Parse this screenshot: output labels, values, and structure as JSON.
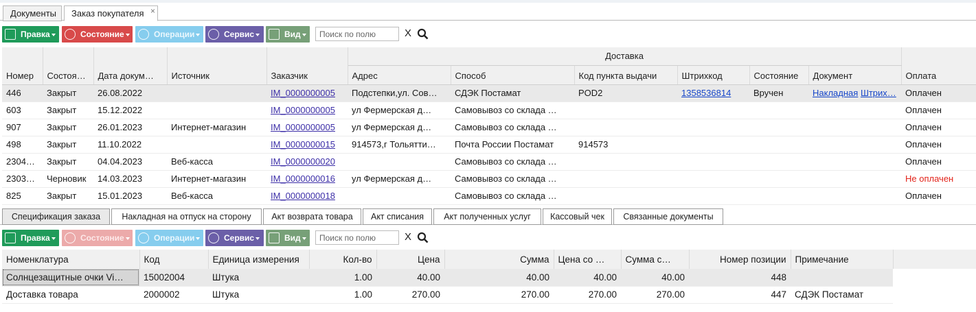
{
  "window_tabs": [
    {
      "label": "Документы"
    },
    {
      "label": "Заказ покупателя",
      "close": "×"
    }
  ],
  "toolbar": {
    "edit": "Правка",
    "state": "Состояние",
    "operations": "Операции",
    "service": "Сервис",
    "view": "Вид",
    "search_placeholder": "Поиск по полю",
    "clear": "X"
  },
  "orders": {
    "group_header": "Доставка",
    "columns": [
      "Номер",
      "Состоя…",
      "Дата докум…",
      "Источник",
      "Заказчик",
      "Адрес",
      "Способ",
      "Код пункта выдачи",
      "Штрихкод",
      "Состояние",
      "Документ",
      "Оплата"
    ],
    "rows": [
      {
        "num": "446",
        "state": "Закрыт",
        "date": "26.08.2022",
        "source": "",
        "customer": "IM_0000000005",
        "address": "Подстепки,ул. Сов…",
        "method": "СДЭК Постамат",
        "pickup": "POD2",
        "barcode": "1358536814",
        "dstate": "Вручен",
        "doc1": "Накладная",
        "doc2": "Штрих…",
        "payment": "Оплачен"
      },
      {
        "num": "603",
        "state": "Закрыт",
        "date": "15.12.2022",
        "source": "",
        "customer": "IM_0000000005",
        "address": "ул Фермерская д…",
        "method": "Самовывоз со склада …",
        "pickup": "",
        "barcode": "",
        "dstate": "",
        "doc1": "",
        "doc2": "",
        "payment": "Оплачен"
      },
      {
        "num": "907",
        "state": "Закрыт",
        "date": "26.01.2023",
        "source": "Интернет-магазин",
        "customer": "IM_0000000005",
        "address": "ул Фермерская д…",
        "method": "Самовывоз со склада …",
        "pickup": "",
        "barcode": "",
        "dstate": "",
        "doc1": "",
        "doc2": "",
        "payment": "Оплачен"
      },
      {
        "num": "498",
        "state": "Закрыт",
        "date": "11.10.2022",
        "source": "",
        "customer": "IM_0000000015",
        "address": "914573,г Тольятти…",
        "method": "Почта России Постамат",
        "pickup": "914573",
        "barcode": "",
        "dstate": "",
        "doc1": "",
        "doc2": "",
        "payment": "Оплачен"
      },
      {
        "num": "2304…",
        "state": "Закрыт",
        "date": "04.04.2023",
        "source": "Веб-касса",
        "customer": "IM_0000000020",
        "address": "",
        "method": "Самовывоз со склада …",
        "pickup": "",
        "barcode": "",
        "dstate": "",
        "doc1": "",
        "doc2": "",
        "payment": "Оплачен"
      },
      {
        "num": "2303…",
        "state": "Черновик",
        "date": "14.03.2023",
        "source": "Интернет-магазин",
        "customer": "IM_0000000016",
        "address": "ул Фермерская д…",
        "method": "Самовывоз со склада …",
        "pickup": "",
        "barcode": "",
        "dstate": "",
        "doc1": "",
        "doc2": "",
        "payment": "Не оплачен"
      },
      {
        "num": "825",
        "state": "Закрыт",
        "date": "15.01.2023",
        "source": "Веб-касса",
        "customer": "IM_0000000018",
        "address": "",
        "method": "Самовывоз со склада …",
        "pickup": "",
        "barcode": "",
        "dstate": "",
        "doc1": "",
        "doc2": "",
        "payment": "Оплачен"
      }
    ]
  },
  "detail_tabs": [
    "Спецификация заказа",
    "Накладная на отпуск на сторону",
    "Акт возврата товара",
    "Акт списания",
    "Акт полученных услуг",
    "Кассовый чек",
    "Связанные документы"
  ],
  "spec": {
    "columns": [
      "Номенклатура",
      "Код",
      "Единица измерения",
      "Кол-во",
      "Цена",
      "Сумма",
      "Цена со …",
      "Сумма с…",
      "Номер позиции",
      "Примечание"
    ],
    "rows": [
      {
        "name": "Солнцезащитные очки Vi…",
        "code": "15002004",
        "unit": "Штука",
        "qty": "1.00",
        "price": "40.00",
        "sum": "40.00",
        "price2": "40.00",
        "sum2": "40.00",
        "pos": "448",
        "note": ""
      },
      {
        "name": "Доставка товара",
        "code": "2000002",
        "unit": "Штука",
        "qty": "1.00",
        "price": "270.00",
        "sum": "270.00",
        "price2": "270.00",
        "sum2": "270.00",
        "pos": "447",
        "note": "СДЭК Постамат"
      }
    ]
  },
  "colors": {
    "edit": "#1f9b5a",
    "state": "#d84a4a",
    "operations": "#86cdee",
    "service": "#6b5fa8",
    "view": "#77a078",
    "unpaid": "#e2231a"
  }
}
